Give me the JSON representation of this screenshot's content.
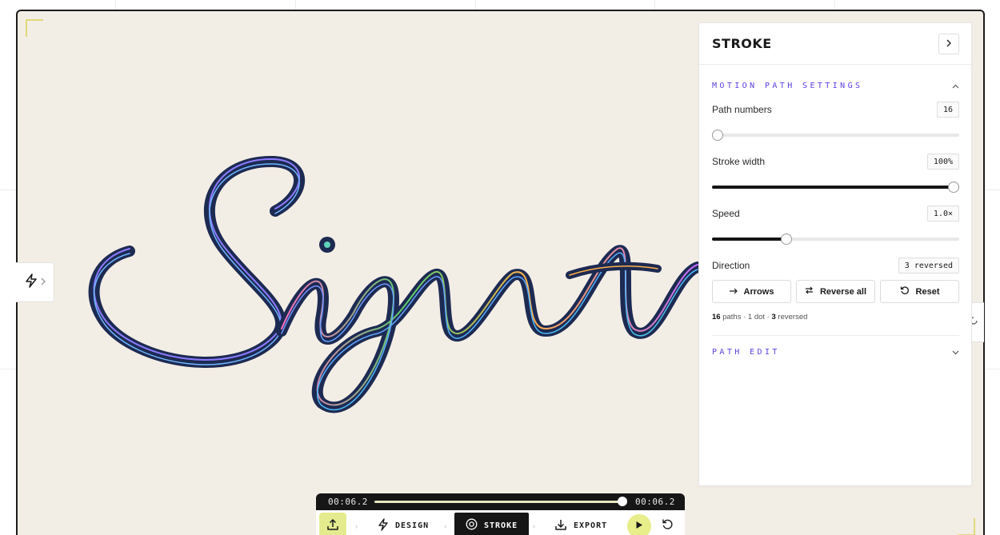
{
  "colors": {
    "canvas_bg": "#f3eee5",
    "accent_purple": "#5b3fe0",
    "accent_lime": "#e4eb8f",
    "ink": "#1d2a52"
  },
  "canvas": {
    "signature_text": "Signatu"
  },
  "left_tab": {
    "icon": "bolt-icon",
    "chevron": "chevron-right-icon"
  },
  "panel": {
    "title": "STROKE",
    "collapse_icon": "chevron-right-icon",
    "sections": {
      "motion": {
        "label": "MOTION PATH SETTINGS",
        "expanded": true,
        "path_numbers": {
          "label": "Path numbers",
          "value": "16",
          "level": 0.0
        },
        "stroke_width": {
          "label": "Stroke width",
          "value": "100%",
          "level": 1.0
        },
        "speed": {
          "label": "Speed",
          "value": "1.0×",
          "level": 0.3
        },
        "direction": {
          "label": "Direction",
          "value": "3 reversed"
        },
        "buttons": {
          "arrows": "Arrows",
          "reverse_all": "Reverse all",
          "reset": "Reset"
        },
        "summary": {
          "paths_count": "16",
          "paths_text": "paths · 1 dot ·",
          "reversed_count": "3",
          "reversed_text": "reversed"
        }
      },
      "path_edit": {
        "label": "PATH EDIT",
        "expanded": false
      }
    }
  },
  "toolbar": {
    "time_start": "00:06.2",
    "time_end": "00:06.2",
    "progress": 1.0,
    "tools": {
      "design": "DESIGN",
      "stroke": "STROKE",
      "export": "EXPORT"
    },
    "active_tool": "stroke"
  }
}
